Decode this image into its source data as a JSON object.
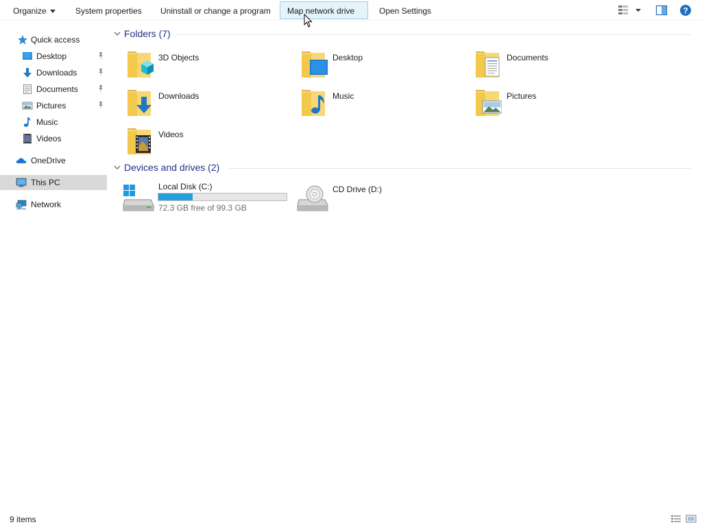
{
  "toolbar": {
    "organize": "Organize",
    "system_properties": "System properties",
    "uninstall": "Uninstall or change a program",
    "map_network_drive": "Map network drive",
    "open_settings": "Open Settings",
    "icons": [
      "change-view-icon",
      "preview-pane-icon",
      "help-icon"
    ]
  },
  "sidebar": {
    "items": [
      {
        "label": "Quick access",
        "icon": "star-icon"
      },
      {
        "label": "Desktop",
        "icon": "desktop-icon",
        "pinned": true
      },
      {
        "label": "Downloads",
        "icon": "download-arrow-icon",
        "pinned": true
      },
      {
        "label": "Documents",
        "icon": "document-icon",
        "pinned": true
      },
      {
        "label": "Pictures",
        "icon": "pictures-icon",
        "pinned": true
      },
      {
        "label": "Music",
        "icon": "music-note-icon"
      },
      {
        "label": "Videos",
        "icon": "film-icon"
      },
      {
        "label": "OneDrive",
        "icon": "cloud-icon"
      },
      {
        "label": "This PC",
        "icon": "computer-icon",
        "selected": true
      },
      {
        "label": "Network",
        "icon": "network-icon"
      }
    ]
  },
  "main": {
    "folders_header": "Folders (7)",
    "folders": [
      {
        "label": "3D Objects",
        "icon": "3d-objects-folder-icon"
      },
      {
        "label": "Desktop",
        "icon": "desktop-folder-icon"
      },
      {
        "label": "Documents",
        "icon": "documents-folder-icon"
      },
      {
        "label": "Downloads",
        "icon": "downloads-folder-icon"
      },
      {
        "label": "Music",
        "icon": "music-folder-icon"
      },
      {
        "label": "Pictures",
        "icon": "pictures-folder-icon"
      },
      {
        "label": "Videos",
        "icon": "videos-folder-icon"
      }
    ],
    "devices_header": "Devices and drives (2)",
    "drives": [
      {
        "label": "Local Disk (C:)",
        "free_text": "72.3 GB free of 99.3 GB",
        "used_fraction": 0.27,
        "icon": "windows-drive-icon"
      },
      {
        "label": "CD Drive (D:)",
        "icon": "cd-drive-icon"
      }
    ]
  },
  "status": {
    "count": "9 items"
  },
  "colors": {
    "accent": "#26a0da",
    "header_blue": "#1e3287",
    "selected_bg": "#d9d9d9",
    "hover_bg": "#e5f3fb"
  }
}
